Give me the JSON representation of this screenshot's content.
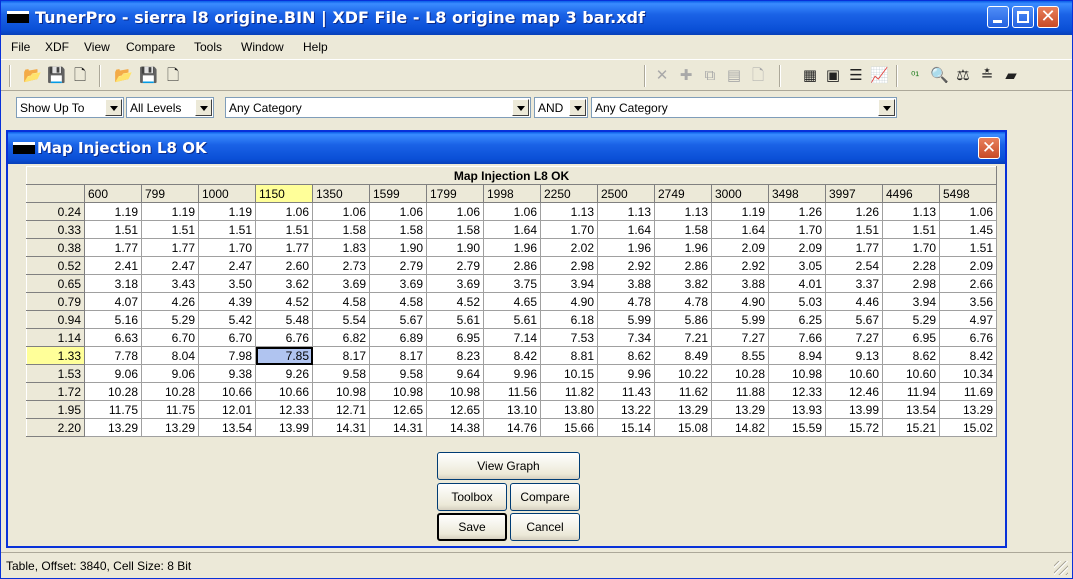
{
  "window": {
    "title": "TunerPro - sierra l8 origine.BIN  |  XDF File - L8 origine map 3 bar.xdf"
  },
  "menu": [
    {
      "label": "File",
      "name": "file"
    },
    {
      "label": "XDF",
      "name": "xdf"
    },
    {
      "label": "View",
      "name": "view"
    },
    {
      "label": "Compare",
      "name": "compare"
    },
    {
      "label": "Tools",
      "name": "tools"
    },
    {
      "label": "Window",
      "name": "window"
    },
    {
      "label": "Help",
      "name": "help"
    }
  ],
  "filters": {
    "show_up_to": "Show Up To",
    "levels": "All Levels",
    "category1": "Any Category",
    "operator": "AND",
    "category2": "Any Category"
  },
  "dialog": {
    "title": "Map Injection L8 OK",
    "table_title": "Map Injection L8 OK",
    "columns": [
      "600",
      "799",
      "1000",
      "1150",
      "1350",
      "1599",
      "1799",
      "1998",
      "2250",
      "2500",
      "2749",
      "3000",
      "3498",
      "3997",
      "4496",
      "5498"
    ],
    "rows": [
      {
        "label": "0.24",
        "values": [
          "1.19",
          "1.19",
          "1.19",
          "1.06",
          "1.06",
          "1.06",
          "1.06",
          "1.06",
          "1.13",
          "1.13",
          "1.13",
          "1.19",
          "1.26",
          "1.26",
          "1.13",
          "1.06"
        ]
      },
      {
        "label": "0.33",
        "values": [
          "1.51",
          "1.51",
          "1.51",
          "1.51",
          "1.58",
          "1.58",
          "1.58",
          "1.64",
          "1.70",
          "1.64",
          "1.58",
          "1.64",
          "1.70",
          "1.51",
          "1.51",
          "1.45"
        ]
      },
      {
        "label": "0.38",
        "values": [
          "1.77",
          "1.77",
          "1.70",
          "1.77",
          "1.83",
          "1.90",
          "1.90",
          "1.96",
          "2.02",
          "1.96",
          "1.96",
          "2.09",
          "2.09",
          "1.77",
          "1.70",
          "1.51"
        ]
      },
      {
        "label": "0.52",
        "values": [
          "2.41",
          "2.47",
          "2.47",
          "2.60",
          "2.73",
          "2.79",
          "2.79",
          "2.86",
          "2.98",
          "2.92",
          "2.86",
          "2.92",
          "3.05",
          "2.54",
          "2.28",
          "2.09"
        ]
      },
      {
        "label": "0.65",
        "values": [
          "3.18",
          "3.43",
          "3.50",
          "3.62",
          "3.69",
          "3.69",
          "3.69",
          "3.75",
          "3.94",
          "3.88",
          "3.82",
          "3.88",
          "4.01",
          "3.37",
          "2.98",
          "2.66"
        ]
      },
      {
        "label": "0.79",
        "values": [
          "4.07",
          "4.26",
          "4.39",
          "4.52",
          "4.58",
          "4.58",
          "4.52",
          "4.65",
          "4.90",
          "4.78",
          "4.78",
          "4.90",
          "5.03",
          "4.46",
          "3.94",
          "3.56"
        ]
      },
      {
        "label": "0.94",
        "values": [
          "5.16",
          "5.29",
          "5.42",
          "5.48",
          "5.54",
          "5.67",
          "5.61",
          "5.61",
          "6.18",
          "5.99",
          "5.86",
          "5.99",
          "6.25",
          "5.67",
          "5.29",
          "4.97"
        ]
      },
      {
        "label": "1.14",
        "values": [
          "6.63",
          "6.70",
          "6.70",
          "6.76",
          "6.82",
          "6.89",
          "6.95",
          "7.14",
          "7.53",
          "7.34",
          "7.21",
          "7.27",
          "7.66",
          "7.27",
          "6.95",
          "6.76"
        ]
      },
      {
        "label": "1.33",
        "values": [
          "7.78",
          "8.04",
          "7.98",
          "7.85",
          "8.17",
          "8.17",
          "8.23",
          "8.42",
          "8.81",
          "8.62",
          "8.49",
          "8.55",
          "8.94",
          "9.13",
          "8.62",
          "8.42"
        ]
      },
      {
        "label": "1.53",
        "values": [
          "9.06",
          "9.06",
          "9.38",
          "9.26",
          "9.58",
          "9.58",
          "9.64",
          "9.96",
          "10.15",
          "9.96",
          "10.22",
          "10.28",
          "10.98",
          "10.60",
          "10.60",
          "10.34"
        ]
      },
      {
        "label": "1.72",
        "values": [
          "10.28",
          "10.28",
          "10.66",
          "10.66",
          "10.98",
          "10.98",
          "10.98",
          "11.56",
          "11.82",
          "11.43",
          "11.62",
          "11.88",
          "12.33",
          "12.46",
          "11.94",
          "11.69"
        ]
      },
      {
        "label": "1.95",
        "values": [
          "11.75",
          "11.75",
          "12.01",
          "12.33",
          "12.71",
          "12.65",
          "12.65",
          "13.10",
          "13.80",
          "13.22",
          "13.29",
          "13.29",
          "13.93",
          "13.99",
          "13.54",
          "13.29"
        ]
      },
      {
        "label": "2.20",
        "values": [
          "13.29",
          "13.29",
          "13.54",
          "13.99",
          "14.31",
          "14.31",
          "14.38",
          "14.76",
          "15.66",
          "15.14",
          "15.08",
          "14.82",
          "15.59",
          "15.72",
          "15.21",
          "15.02"
        ]
      }
    ],
    "selected_row": 8,
    "selected_col": 3,
    "buttons": {
      "view_graph": "View Graph",
      "toolbox": "Toolbox",
      "compare": "Compare",
      "save": "Save",
      "cancel": "Cancel"
    }
  },
  "status": {
    "text": "Table, Offset: 3840,  Cell Size: 8 Bit"
  },
  "colors": {
    "title_blue": "#0a4fd6",
    "highlight_header": "#ffff99",
    "selected_cell": "#b0c4f0"
  }
}
